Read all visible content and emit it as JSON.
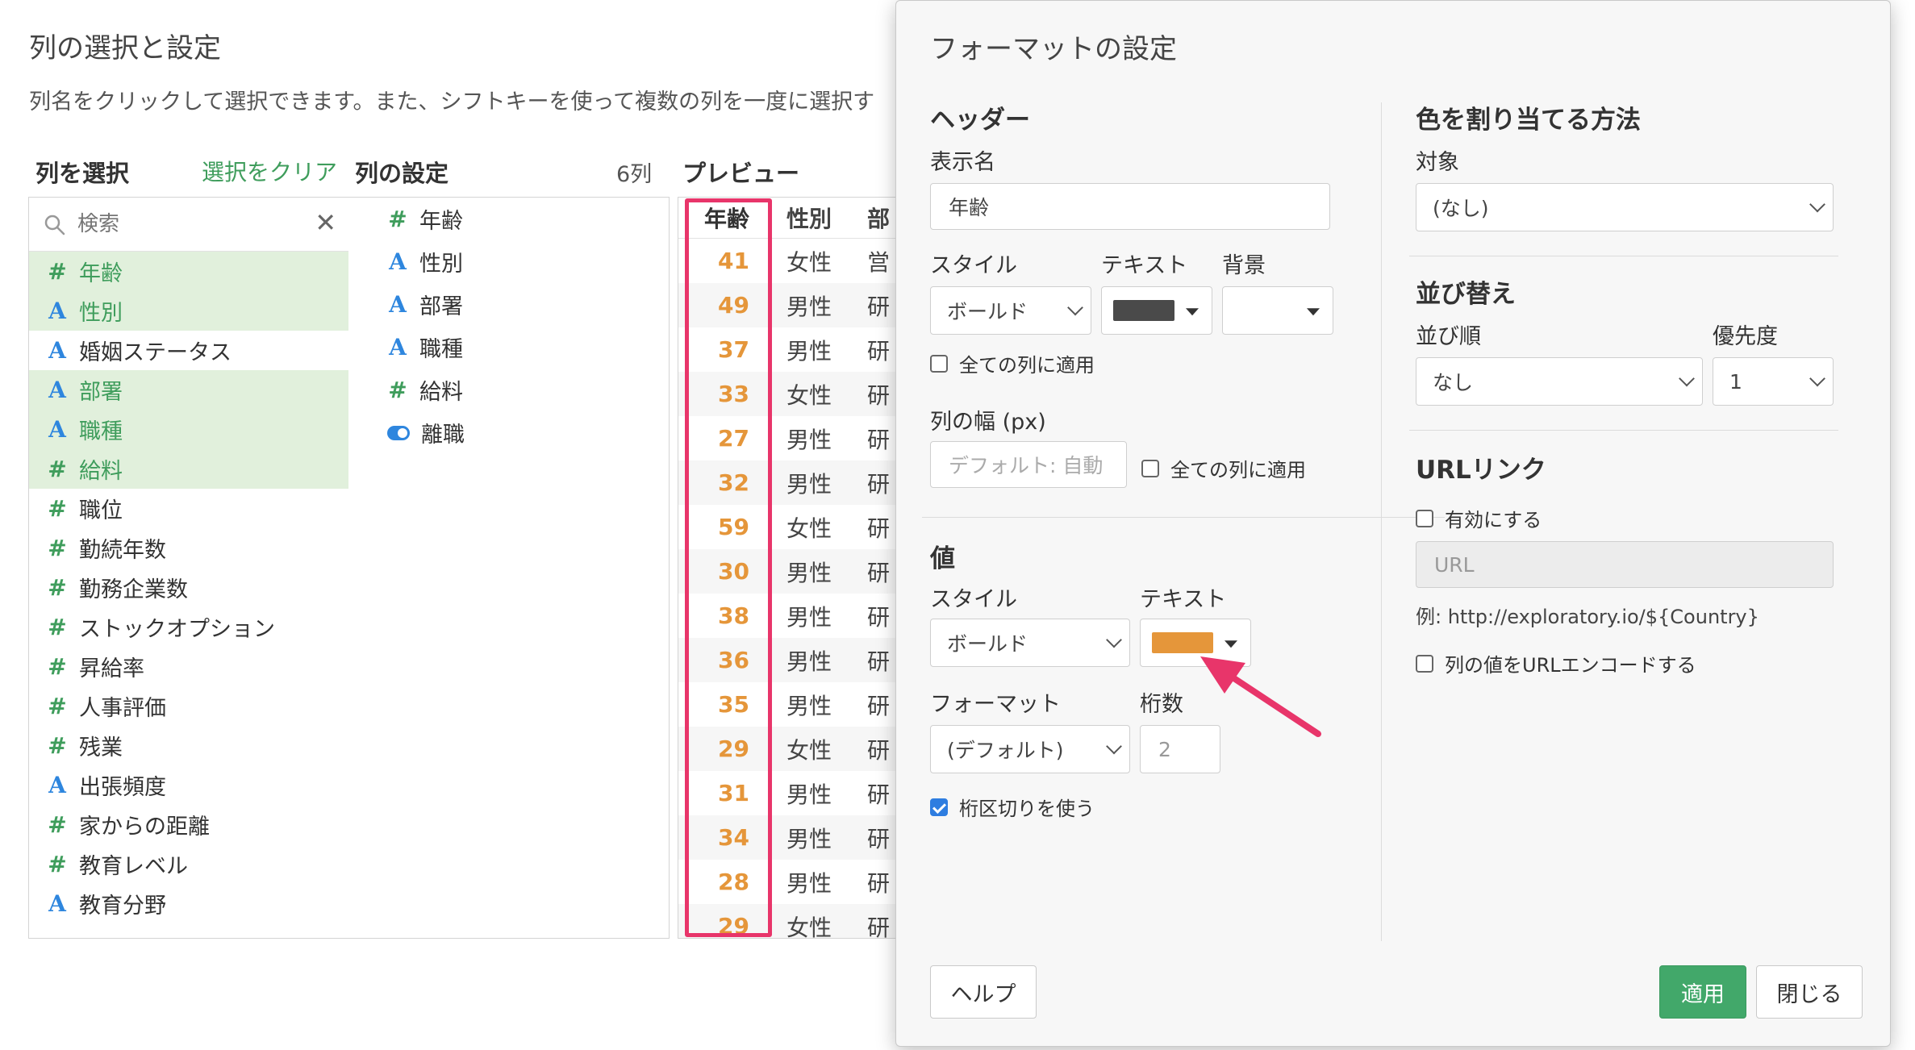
{
  "page": {
    "title": "列の選択と設定",
    "description": "列名をクリックして選択できます。また、シフトキーを使って複数の列を一度に選択す",
    "select_header": "列を選択",
    "clear_selection": "選択をクリア",
    "settings_header": "列の設定",
    "column_count": "6列",
    "preview_header": "プレビュー",
    "search_placeholder": "検索"
  },
  "columns": [
    {
      "type": "#",
      "kind": "num",
      "name": "年齢",
      "selected": true
    },
    {
      "type": "A",
      "kind": "str",
      "name": "性別",
      "selected": true
    },
    {
      "type": "A",
      "kind": "str",
      "name": "婚姻ステータス",
      "selected": false
    },
    {
      "type": "A",
      "kind": "str",
      "name": "部署",
      "selected": true
    },
    {
      "type": "A",
      "kind": "str",
      "name": "職種",
      "selected": true
    },
    {
      "type": "#",
      "kind": "num",
      "name": "給料",
      "selected": true
    },
    {
      "type": "#",
      "kind": "num",
      "name": "職位",
      "selected": false
    },
    {
      "type": "#",
      "kind": "num",
      "name": "勤続年数",
      "selected": false
    },
    {
      "type": "#",
      "kind": "num",
      "name": "勤務企業数",
      "selected": false
    },
    {
      "type": "#",
      "kind": "num",
      "name": "ストックオプション",
      "selected": false
    },
    {
      "type": "#",
      "kind": "num",
      "name": "昇給率",
      "selected": false
    },
    {
      "type": "#",
      "kind": "num",
      "name": "人事評価",
      "selected": false
    },
    {
      "type": "#",
      "kind": "num",
      "name": "残業",
      "selected": false
    },
    {
      "type": "A",
      "kind": "str",
      "name": "出張頻度",
      "selected": false
    },
    {
      "type": "#",
      "kind": "num",
      "name": "家からの距離",
      "selected": false
    },
    {
      "type": "#",
      "kind": "num",
      "name": "教育レベル",
      "selected": false
    },
    {
      "type": "A",
      "kind": "str",
      "name": "教育分野",
      "selected": false
    }
  ],
  "selected_settings": [
    {
      "type": "#",
      "kind": "num",
      "name": "年齢"
    },
    {
      "type": "A",
      "kind": "str",
      "name": "性別"
    },
    {
      "type": "A",
      "kind": "str",
      "name": "部署"
    },
    {
      "type": "A",
      "kind": "str",
      "name": "職種"
    },
    {
      "type": "#",
      "kind": "num",
      "name": "給料"
    },
    {
      "type": "toggle",
      "kind": "bool",
      "name": "離職"
    }
  ],
  "preview": {
    "headers": [
      "年齢",
      "性別",
      "部"
    ],
    "rows": [
      [
        "41",
        "女性",
        "営"
      ],
      [
        "49",
        "男性",
        "研"
      ],
      [
        "37",
        "男性",
        "研"
      ],
      [
        "33",
        "女性",
        "研"
      ],
      [
        "27",
        "男性",
        "研"
      ],
      [
        "32",
        "男性",
        "研"
      ],
      [
        "59",
        "女性",
        "研"
      ],
      [
        "30",
        "男性",
        "研"
      ],
      [
        "38",
        "男性",
        "研"
      ],
      [
        "36",
        "男性",
        "研"
      ],
      [
        "35",
        "男性",
        "研"
      ],
      [
        "29",
        "女性",
        "研"
      ],
      [
        "31",
        "男性",
        "研"
      ],
      [
        "34",
        "男性",
        "研"
      ],
      [
        "28",
        "男性",
        "研"
      ],
      [
        "29",
        "女性",
        "研"
      ]
    ],
    "age_color": "#e5963a"
  },
  "modal": {
    "title": "フォーマットの設定",
    "header_section": {
      "title": "ヘッダー",
      "display_name_label": "表示名",
      "display_name_value": "年齢",
      "style_label": "スタイル",
      "text_label": "テキスト",
      "bg_label": "背景",
      "style_value": "ボールド",
      "text_color": "#4a4a4a",
      "apply_all_label": "全ての列に適用",
      "width_label": "列の幅 (px)",
      "width_placeholder": "デフォルト: 自動",
      "width_apply_all_label": "全ての列に適用"
    },
    "value_section": {
      "title": "値",
      "style_label": "スタイル",
      "text_label": "テキスト",
      "style_value": "ボールド",
      "text_color": "#e5963a",
      "format_label": "フォーマット",
      "digits_label": "桁数",
      "format_value": "(デフォルト)",
      "digits_value": "2",
      "separator_label": "桁区切りを使う",
      "separator_checked": true
    },
    "color_section": {
      "title": "色を割り当てる方法",
      "target_label": "対象",
      "target_value": "(なし)"
    },
    "sort_section": {
      "title": "並び替え",
      "order_label": "並び順",
      "priority_label": "優先度",
      "order_value": "なし",
      "priority_value": "1"
    },
    "url_section": {
      "title": "URLリンク",
      "enable_label": "有効にする",
      "url_placeholder": "URL",
      "example": "例: http://exploratory.io/${Country}",
      "encode_label": "列の値をURLエンコードする"
    },
    "buttons": {
      "help": "ヘルプ",
      "apply": "適用",
      "close": "閉じる"
    }
  },
  "annotation": {
    "highlight_color": "#e8356a"
  }
}
